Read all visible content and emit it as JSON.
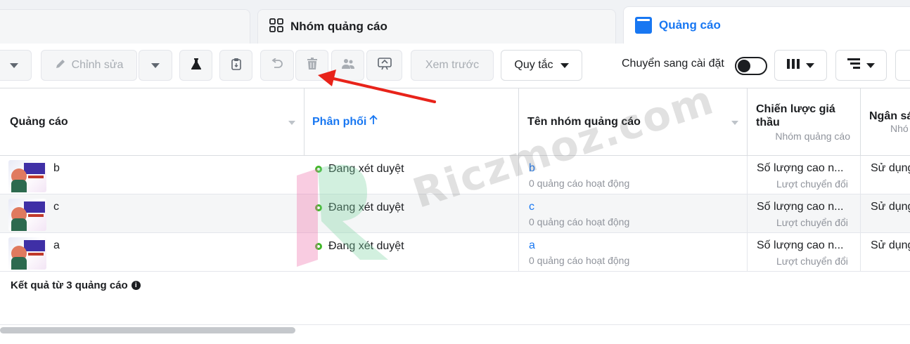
{
  "tabs": {
    "adset": {
      "label": "Nhóm quảng cáo",
      "icon": "grid-icon"
    },
    "ads": {
      "label": "Quảng cáo",
      "icon": "ad-icon",
      "color": "#1877f2"
    }
  },
  "toolbar": {
    "edit_label": "Chỉnh sửa",
    "preview_label": "Xem trước",
    "rules_label": "Quy tắc",
    "switch_label": "Chuyển sang cài đặt",
    "icons": [
      "pencil-icon",
      "flask-icon",
      "clipboard-icon",
      "undo-icon",
      "trash-icon",
      "people-icon",
      "share-icon",
      "columns-icon",
      "breakdown-icon"
    ]
  },
  "table": {
    "headers": {
      "ad": "Quảng cáo",
      "delivery": "Phân phối",
      "adset_name": "Tên nhóm quảng cáo",
      "bid_strategy": "Chiến lược giá thầu",
      "bid_strategy_sub": "Nhóm quảng cáo",
      "budget": "Ngân sá",
      "budget_sub": "Nhó"
    },
    "rows": [
      {
        "name": "b",
        "status": "Đang xét duyệt",
        "adset": "b",
        "adset_sub": "0 quảng cáo hoạt động",
        "bid": "Số lượng cao n...",
        "bid_sub": "Lượt chuyển đổi",
        "budget": "Sử dụng"
      },
      {
        "name": "c",
        "status": "Đang xét duyệt",
        "adset": "c",
        "adset_sub": "0 quảng cáo hoạt động",
        "bid": "Số lượng cao n...",
        "bid_sub": "Lượt chuyển đổi",
        "budget": "Sử dụng"
      },
      {
        "name": "a",
        "status": "Đang xét duyệt",
        "adset": "a",
        "adset_sub": "0 quảng cáo hoạt động",
        "bid": "Số lượng cao n...",
        "bid_sub": "Lượt chuyển đổi",
        "budget": "Sử dụng"
      }
    ],
    "summary": "Kết quả từ 3 quảng cáo"
  },
  "watermark": {
    "text": "Riczmoz.com"
  },
  "colors": {
    "accent": "#1877f2",
    "status_green": "#42b72a",
    "annotation_red": "#e8231a"
  }
}
